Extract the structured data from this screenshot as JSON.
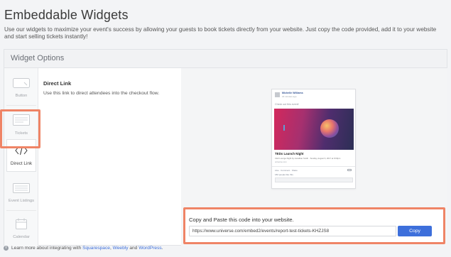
{
  "page": {
    "title": "Embeddable Widgets",
    "intro": "Use our widgets to maximize your event's success by allowing your guests to book tickets directly from your website. Just copy the code provided, add it to your website and start selling tickets instantly!"
  },
  "panel": {
    "header": "Widget Options"
  },
  "tabs": [
    {
      "label": "Button",
      "icon": "button-icon",
      "active": false
    },
    {
      "label": "Tickets",
      "icon": "tickets-icon",
      "active": false
    },
    {
      "label": "Direct Link",
      "icon": "code-icon",
      "active": true
    },
    {
      "label": "Event Listings",
      "icon": "event-listings-icon",
      "active": false
    },
    {
      "label": "Calendar",
      "icon": "calendar-icon",
      "active": false
    }
  ],
  "selected": {
    "title": "Direct Link",
    "description": "Use this link to direct attendees into the checkout flow."
  },
  "preview": {
    "author": "Michelle Williams",
    "time": "22 minutes ago",
    "post_text": "Check out this event!",
    "event_title": "TEDx Launch Night",
    "event_meta": "Club Lounge Night by Jonathan Smith · Sunday, August 6, 2017 at 9:00pm",
    "event_host": "universe.com",
    "actions": "Like · Comment · Share",
    "likes": "182 people like this."
  },
  "code": {
    "label": "Copy and Paste this code into your website.",
    "value": "https://www.universe.com/embed2/events/report-test-tickets-KHZJS8",
    "copy_label": "Copy"
  },
  "footer": {
    "prefix": "Learn more about integrating with",
    "link1": "Squarespace",
    "sep1": ",",
    "link2": "Weebly",
    "sep2": "and",
    "link3": "WordPress",
    "suffix": "."
  },
  "colors": {
    "accent_blue": "#3d6fdb",
    "highlight": "#ef8466"
  }
}
